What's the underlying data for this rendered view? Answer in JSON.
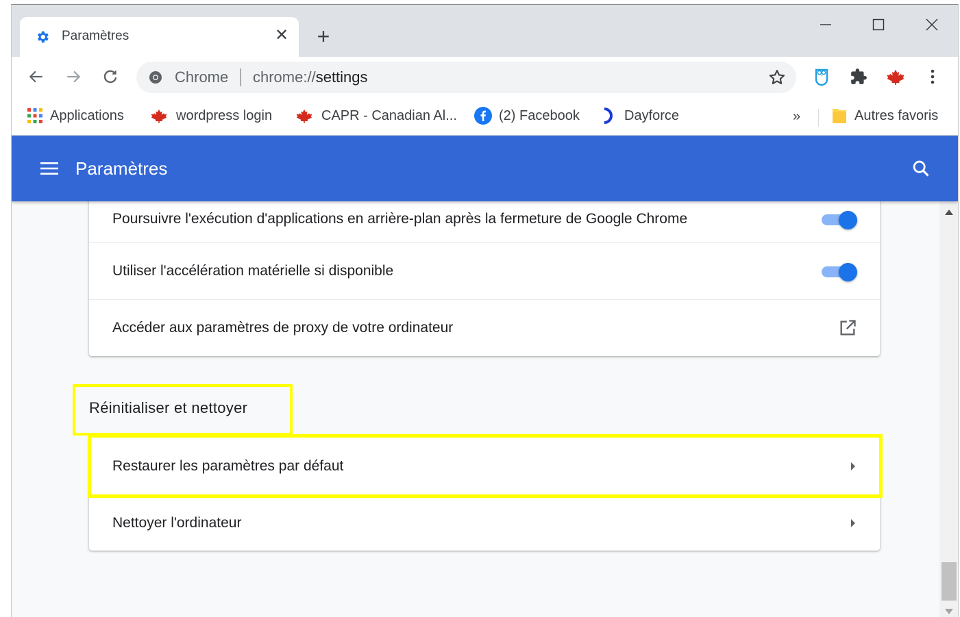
{
  "tab": {
    "title": "Paramètres",
    "close_glyph": "✕",
    "new_tab_glyph": "+"
  },
  "window_controls": {
    "minimize": "minimize-icon",
    "maximize": "maximize-icon",
    "close": "close-icon"
  },
  "omnibox": {
    "site_chip": "Chrome",
    "url_prefix": "chrome://",
    "url_path": "settings"
  },
  "bookmarks": {
    "items": [
      {
        "label": "Applications",
        "icon": "apps-grid-icon"
      },
      {
        "label": "wordpress login",
        "icon": "maple-leaf-icon"
      },
      {
        "label": "CAPR - Canadian Al...",
        "icon": "maple-leaf-icon"
      },
      {
        "label": "(2) Facebook",
        "icon": "facebook-icon"
      },
      {
        "label": "Dayforce",
        "icon": "dayforce-icon"
      }
    ],
    "more": "»",
    "other": "Autres favoris"
  },
  "header": {
    "title": "Paramètres"
  },
  "system_card": {
    "rows": [
      {
        "label": "Poursuivre l'exécution d'applications en arrière-plan après la fermeture de Google Chrome",
        "control": "toggle",
        "on": true
      },
      {
        "label": "Utiliser l'accélération matérielle si disponible",
        "control": "toggle",
        "on": true
      },
      {
        "label": "Accéder aux paramètres de proxy de votre ordinateur",
        "control": "external-link"
      }
    ]
  },
  "reset_section": {
    "title": "Réinitialiser et nettoyer",
    "rows": [
      {
        "label": "Restaurer les paramètres par défaut",
        "control": "arrow"
      },
      {
        "label": "Nettoyer l'ordinateur",
        "control": "arrow"
      }
    ]
  },
  "colors": {
    "header_blue": "#3367d6",
    "toggle_on": "#1a73e8",
    "highlight": "#ffff00"
  }
}
